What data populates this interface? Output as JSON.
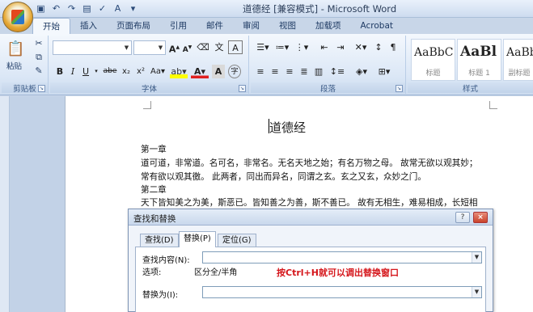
{
  "colors": {
    "accent": "#d5161b",
    "ribbon": "#dbe7f6",
    "titlebar": "#cddcef"
  },
  "window": {
    "title": "道德经 [兼容模式] - Microsoft Word"
  },
  "tabs": [
    "开始",
    "插入",
    "页面布局",
    "引用",
    "邮件",
    "审阅",
    "视图",
    "加载项",
    "Acrobat"
  ],
  "ribbon": {
    "groups": {
      "clipboard": "剪贴板",
      "font": "字体",
      "paragraph": "段落",
      "styles": "样式"
    },
    "paste_label": "粘贴",
    "styles": [
      {
        "sample": "AaBbC",
        "name": "标题"
      },
      {
        "sample": "AaBl",
        "name": "标题 1"
      },
      {
        "sample": "AaBb",
        "name": "副标题"
      }
    ]
  },
  "document": {
    "title": "道德经",
    "lines": [
      "第一章",
      "道可道，非常道。名可名，非常名。无名天地之始；有名万物之母。 故常无欲以观其妙；",
      "常有欲以观其徼。 此两者，同出而异名，同谓之玄。玄之又玄，众妙之门。",
      "第二章",
      "天下皆知美之为美，斯恶已。皆知善之为善，斯不善已。 故有无相生，难易相成，长短相"
    ]
  },
  "dialog": {
    "title": "查找和替换",
    "tabs": [
      "查找(D)",
      "替换(P)",
      "定位(G)"
    ],
    "active_tab": "替换(P)",
    "find_label": "查找内容(N):",
    "options_label": "选项:",
    "options_value": "区分全/半角",
    "replace_label": "替换为(I):",
    "find_value": "",
    "replace_value": "",
    "hint": "按Ctrl+H就可以调出替换窗口",
    "help_button": "?",
    "close_button": "×"
  }
}
